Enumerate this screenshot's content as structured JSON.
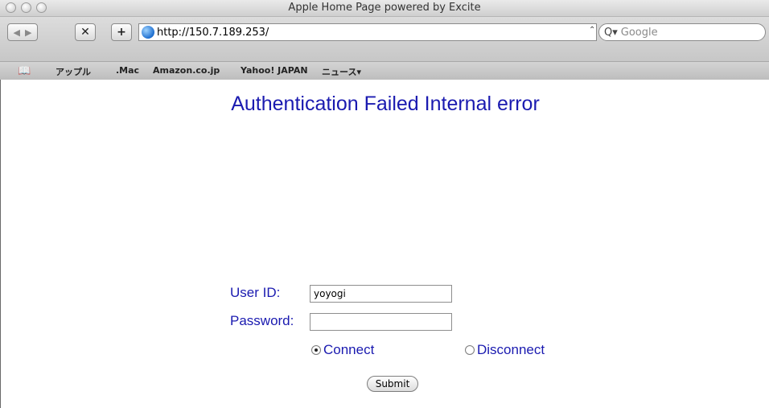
{
  "window": {
    "title": "Apple Home Page powered by Excite"
  },
  "toolbar": {
    "back_glyph": "◀",
    "forward_glyph": "▶",
    "stop_glyph": "✕",
    "add_glyph": "+",
    "url": "http://150.7.189.253/",
    "search_placeholder": "Google",
    "search_up_glyph": "⌃",
    "search_icon_glyph": "Q▾"
  },
  "bookmarks": {
    "book_glyph": "📖",
    "items": [
      "アップル",
      ".Mac",
      "Amazon.co.jp",
      "Yahoo! JAPAN",
      "ニュース▾"
    ]
  },
  "page": {
    "heading": "Authentication Failed Internal error",
    "user_id_label": "User ID:",
    "user_id_value": "yoyogi",
    "password_label": "Password:",
    "password_value": "",
    "connect_label": "Connect",
    "disconnect_label": "Disconnect",
    "submit_label": "Submit",
    "selected_action": "Connect"
  },
  "colors": {
    "heading": "#1a1ab0",
    "label": "#1a1ab0"
  }
}
